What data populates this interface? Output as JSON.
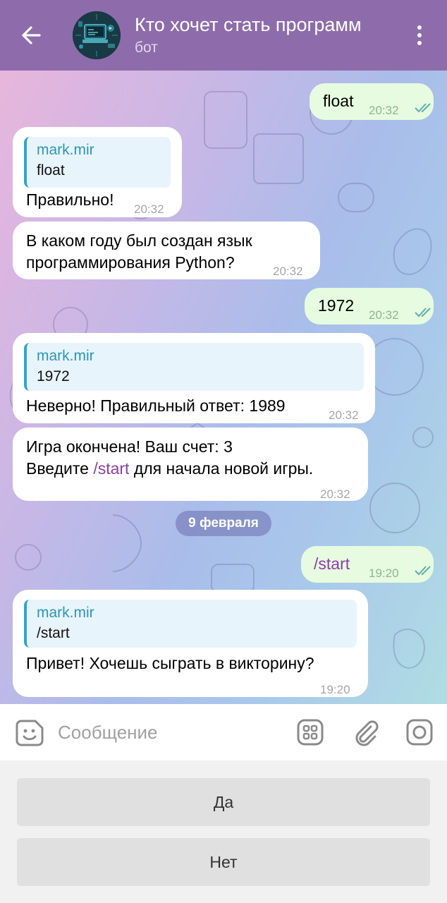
{
  "header": {
    "title": "Кто хочет стать программ",
    "subtitle": "бот",
    "bg_color": "#8e6cab"
  },
  "messages": [
    {
      "type": "out",
      "text": "float",
      "time": "20:32",
      "status": "read"
    },
    {
      "type": "in",
      "reply_name": "mark.mir",
      "reply_text": "float",
      "text": "Правильно!",
      "time": "20:32"
    },
    {
      "type": "in",
      "line1": "В каком году был создан язык",
      "line2": "программирования Python?",
      "time": "20:32"
    },
    {
      "type": "out",
      "text": "1972",
      "time": "20:32",
      "status": "read"
    },
    {
      "type": "in",
      "reply_name": "mark.mir",
      "reply_text": "1972",
      "text": "Неверно! Правильный ответ: 1989",
      "time": "20:32"
    },
    {
      "type": "in",
      "line1": "Игра окончена! Ваш счет: 3",
      "line2_pre": "Введите ",
      "line2_cmd": "/start",
      "line2_post": " для начала новой игры.",
      "time": "20:32"
    },
    {
      "type": "out",
      "text": "/start",
      "time": "19:20",
      "status": "read"
    },
    {
      "type": "in",
      "reply_name": "mark.mir",
      "reply_text": "/start",
      "text": "Привет! Хочешь сыграть в викторину?",
      "time": "19:20"
    }
  ],
  "date_separator": "9 февраля",
  "composer": {
    "placeholder": "Сообщение"
  },
  "keyboard": {
    "buttons": [
      "Да",
      "Нет"
    ]
  }
}
